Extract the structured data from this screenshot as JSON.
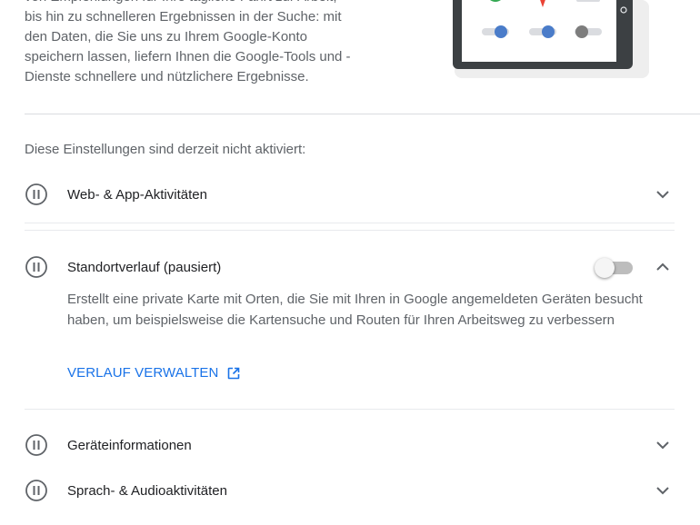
{
  "intro": {
    "lines": [
      "von Empfehlungen für Ihre tägliche Fahrt zur Arbeit,",
      "bis hin zu schnelleren Ergebnissen in der Suche: mit",
      "den Daten, die Sie uns zu Ihrem Google-Konto",
      "speichern lassen, liefern Ihnen die Google-Tools und -",
      "Dienste schnellere und nützlichere Ergebnisse."
    ]
  },
  "status_note": "Diese Einstellungen sind derzeit nicht aktiviert:",
  "settings": {
    "web_app": {
      "label": "Web- & App-Aktivitäten"
    },
    "location": {
      "label": "Standortverlauf (pausiert)",
      "description": "Erstellt eine private Karte mit Orten, die Sie mit Ihren in Google angemeldeten Geräten besucht haben, um beispielsweise die Kartensuche und Routen für Ihren Arbeitsweg zu verbessern",
      "manage_link": "VERLAUF VERWALTEN",
      "enabled": false
    },
    "device": {
      "label": "Geräteinformationen"
    },
    "voice": {
      "label": "Sprach- & Audioaktivitäten"
    }
  },
  "colors": {
    "accent": "#1a73e8",
    "icon_gray": "#5f6368",
    "divider": "#dadce0"
  },
  "icons": {
    "paused": "pause-circle-icon",
    "expand": "chevron-down-icon",
    "collapse": "chevron-up-icon",
    "external": "open-in-new-icon"
  }
}
